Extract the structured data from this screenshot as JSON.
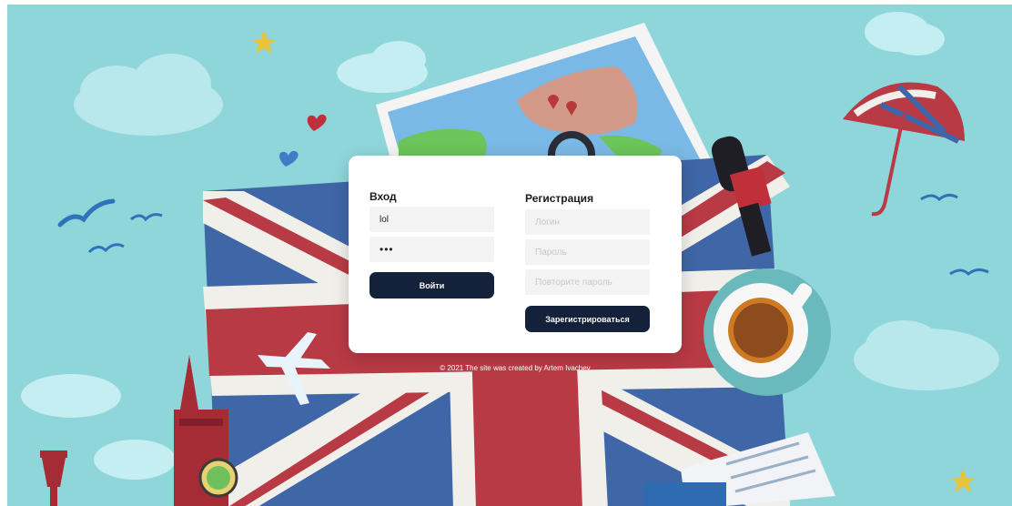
{
  "login": {
    "title": "Вход",
    "username_value": "lol",
    "password_value": "lol",
    "submit_label": "Войти"
  },
  "register": {
    "title": "Регистрация",
    "login_placeholder": "Логин",
    "password_placeholder": "Пароль",
    "repeat_password_placeholder": "Повторите пароль",
    "submit_label": "Зарегистрироваться"
  },
  "footer": {
    "text": "© 2021 The site was created by Artem Ivachev"
  },
  "theme": {
    "background": "#8fd6db",
    "button": "#14213b",
    "flag_red": "#b83a45",
    "flag_blue": "#3f66a6"
  }
}
